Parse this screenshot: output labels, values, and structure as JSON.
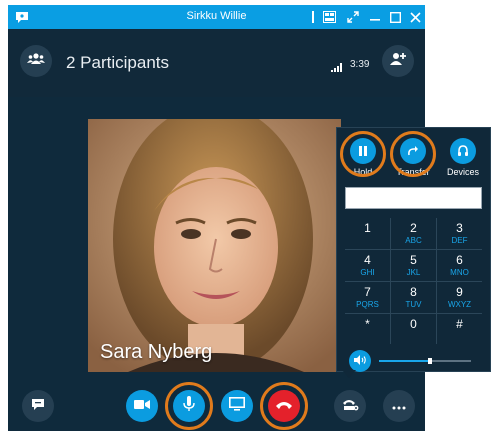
{
  "window": {
    "title": "Sirkku Willie"
  },
  "header": {
    "participants_label": "2 Participants",
    "call_timer": "3:39"
  },
  "video": {
    "caller_name": "Sara Nyberg"
  },
  "dialpad": {
    "actions": [
      {
        "label": "Hold",
        "icon": "pause-icon"
      },
      {
        "label": "Transfer",
        "icon": "transfer-icon"
      },
      {
        "label": "Devices",
        "icon": "headset-icon"
      }
    ],
    "input_value": "",
    "keys": [
      {
        "num": "1",
        "letters": ""
      },
      {
        "num": "2",
        "letters": "ABC"
      },
      {
        "num": "3",
        "letters": "DEF"
      },
      {
        "num": "4",
        "letters": "GHI"
      },
      {
        "num": "5",
        "letters": "JKL"
      },
      {
        "num": "6",
        "letters": "MNO"
      },
      {
        "num": "7",
        "letters": "PQRS"
      },
      {
        "num": "8",
        "letters": "TUV"
      },
      {
        "num": "9",
        "letters": "WXYZ"
      },
      {
        "num": "*",
        "letters": ""
      },
      {
        "num": "0",
        "letters": ""
      },
      {
        "num": "#",
        "letters": ""
      }
    ],
    "volume_level": 0.55
  },
  "toolbar": {
    "buttons": [
      "chat-icon",
      "video-camera-icon",
      "microphone-icon",
      "present-screen-icon",
      "hang-up-icon",
      "call-controls-icon",
      "more-options-icon"
    ]
  },
  "colors": {
    "accent": "#0b9ce0",
    "titlebar": "#0a9ee3",
    "hangup": "#e4212b",
    "highlight_ring": "#e07b1c",
    "background": "#0f2a3c"
  }
}
